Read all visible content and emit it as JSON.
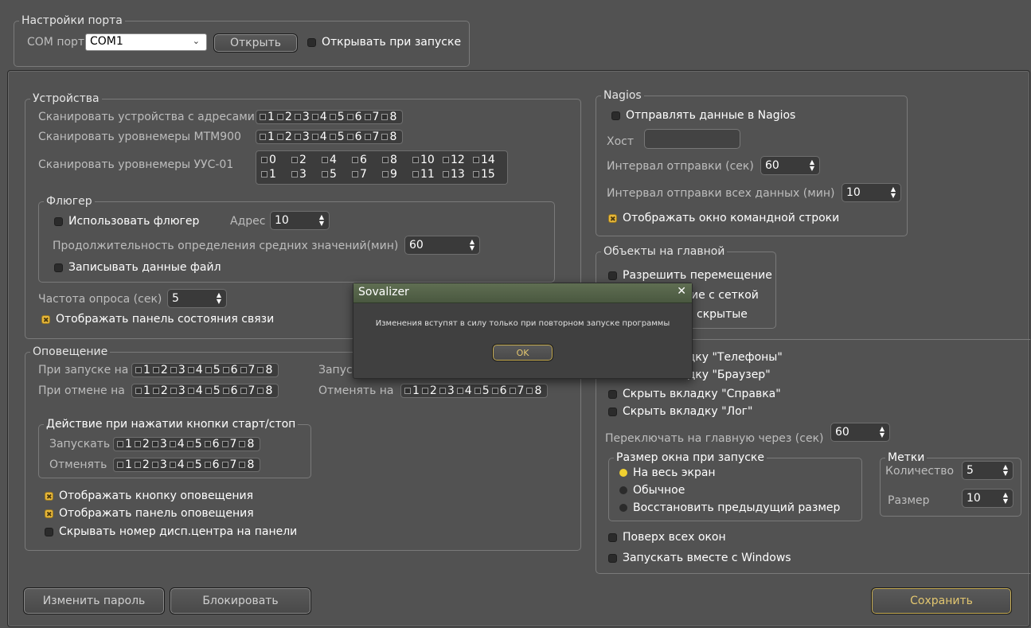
{
  "port_settings": {
    "title": "Настройки порта",
    "com_label": "COM порт",
    "com_value": "COM1",
    "open_button": "Открыть",
    "open_on_start": "Открывать при запуске"
  },
  "devices": {
    "title": "Устройства",
    "scan_addresses_label": "Сканировать устройства с адресами",
    "scan_mtm_label": "Сканировать уровнемеры МТМ900",
    "scan_uus_label": "Сканировать уровнемеры УУС-01",
    "addr_1_8": [
      "1",
      "2",
      "3",
      "4",
      "5",
      "6",
      "7",
      "8"
    ],
    "addr_0_15_row1": [
      "0",
      "2",
      "4",
      "6",
      "8",
      "10",
      "12",
      "14"
    ],
    "addr_0_15_row2": [
      "1",
      "3",
      "5",
      "7",
      "9",
      "11",
      "13",
      "15"
    ],
    "vane": {
      "title": "Флюгер",
      "use_label": "Использовать флюгер",
      "addr_label": "Адрес",
      "addr_value": "10",
      "avg_label": "Продолжительность определения средних значений(мин)",
      "avg_value": "60",
      "write_file_label": "Записывать данные файл"
    },
    "poll_label": "Частота опроса (сек)",
    "poll_value": "5",
    "show_status_panel": "Отображать панель состояния связи"
  },
  "notification": {
    "title": "Оповещение",
    "on_start_label": "При запуске на",
    "start_label2": "Запус",
    "on_cancel_label": "При отмене на",
    "cancel_label2": "Отменять на",
    "action": {
      "title": "Действие при нажатии кнопки старт/стоп",
      "start_label": "Запускать",
      "cancel_label": "Отменять"
    },
    "show_button": "Отображать кнопку оповещения",
    "show_panel": "Отображать панель оповещения",
    "hide_number": "Скрывать номер дисп.центра на панели"
  },
  "nagios": {
    "title": "Nagios",
    "send_label": "Отправлять данные в Nagios",
    "host_label": "Хост",
    "host_value": "",
    "interval_label": "Интервал отправки (сек)",
    "interval_value": "60",
    "interval_all_label": "Интервал отправки всех данных (мин)",
    "interval_all_value": "10",
    "show_cmd": "Отображать окно командной строки"
  },
  "objects": {
    "title": "Объекты на главной",
    "allow_move": "Разрешить перемещение",
    "grid_partial": "ие с сеткой",
    "hidden_partial": "скрытые"
  },
  "tabs": {
    "phones_partial": "адку \"Телефоны\"",
    "browser_partial": "адку \"Браузер\"",
    "hide_help": "Скрыть вкладку \"Справка\"",
    "hide_log": "Скрыть вкладку \"Лог\"",
    "switch_label": "Переключать на главную через (сек)",
    "switch_value": "60"
  },
  "window_size": {
    "title": "Размер окна при запуске",
    "full": "На весь экран",
    "normal": "Обычное",
    "restore": "Восстановить предыдущий размер"
  },
  "marks": {
    "title": "Метки",
    "count_label": "Количество",
    "count_value": "5",
    "size_label": "Размер",
    "size_value": "10"
  },
  "on_top": "Поверх всех окон",
  "autostart": "Запускать вместе с Windows",
  "buttons": {
    "change_password": "Изменить пароль",
    "lock": "Блокировать",
    "save": "Сохранить"
  },
  "dialog": {
    "title": "Sovalizer",
    "close": "✕",
    "message": "Изменения вступят в силу только при повторном запуске программы",
    "ok": "OK"
  },
  "colors": {
    "background": "#525252",
    "accent": "#e8b73a",
    "dialog_header": "#56644a"
  }
}
